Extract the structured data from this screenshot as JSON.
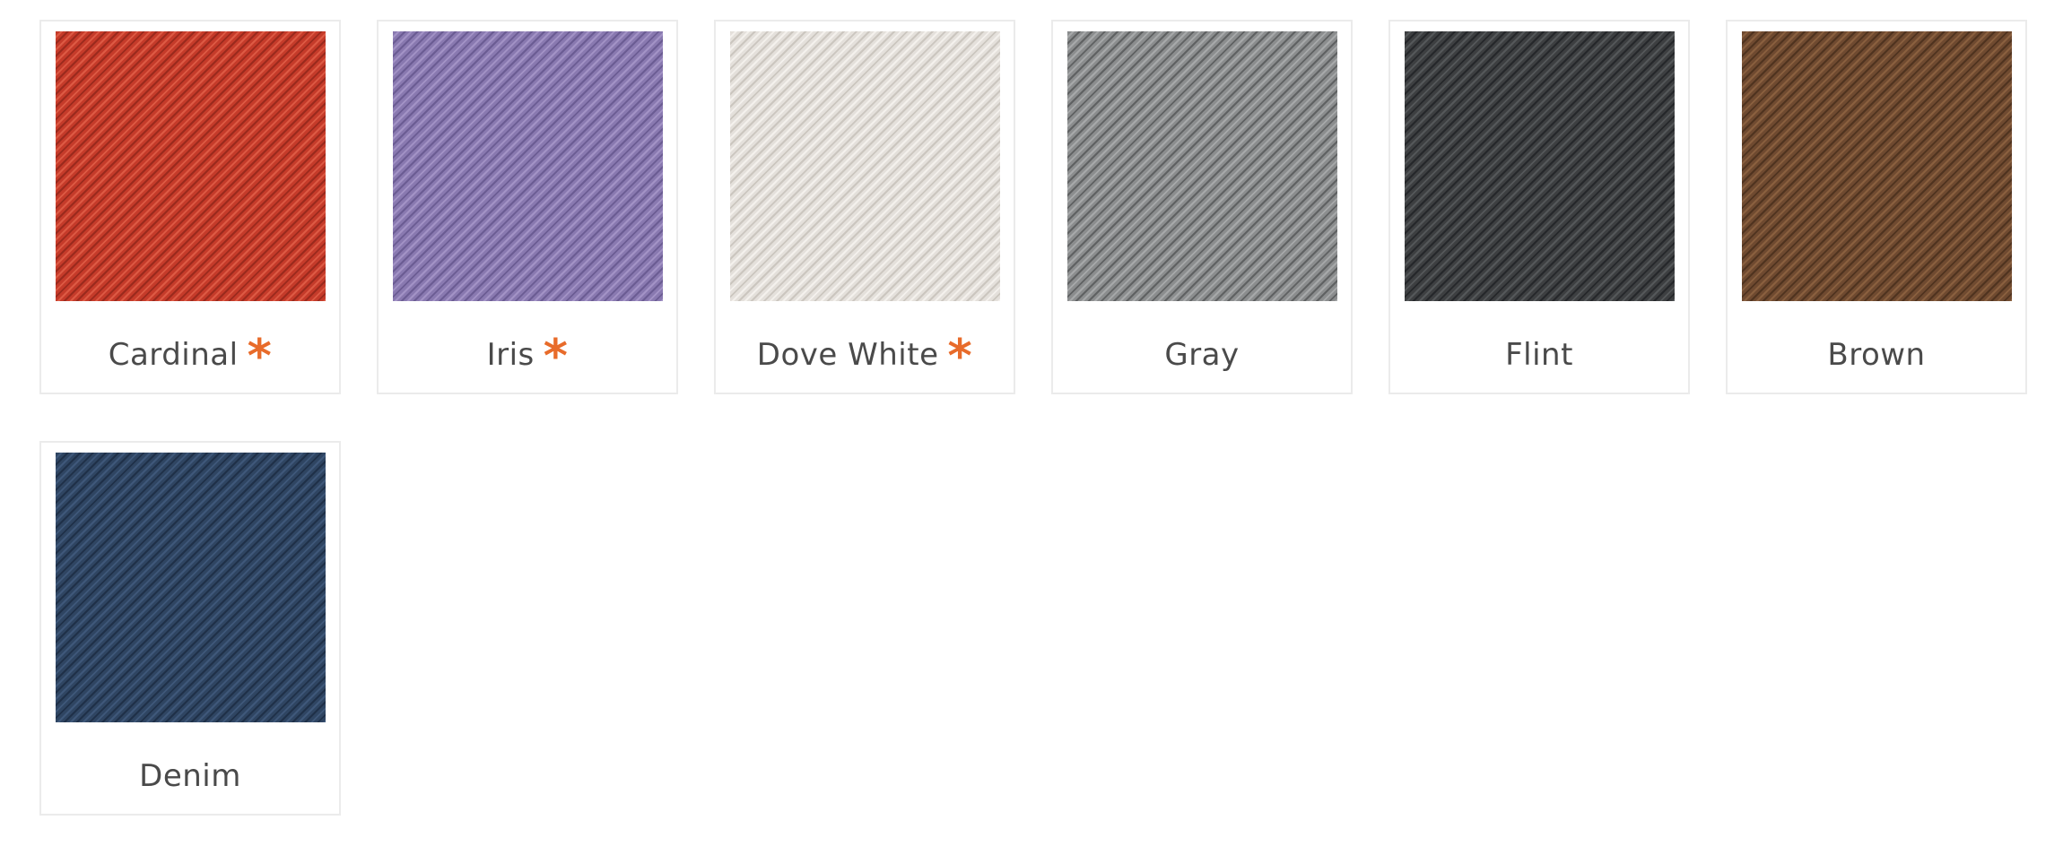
{
  "colors": {
    "accent_asterisk": "#e86b2a",
    "label_text": "#4a4a4a",
    "card_border": "#ebebeb"
  },
  "marker_symbol": "*",
  "swatches": [
    {
      "name": "Cardinal",
      "marked": true,
      "base": "#c53b2a",
      "light": "#dd5a44",
      "dark": "#9a2a1d"
    },
    {
      "name": "Iris",
      "marked": true,
      "base": "#8979b0",
      "light": "#a393c6",
      "dark": "#6b5c93"
    },
    {
      "name": "Dove White",
      "marked": true,
      "base": "#e4e0db",
      "light": "#f4f1ed",
      "dark": "#cbc6bf"
    },
    {
      "name": "Gray",
      "marked": false,
      "base": "#8b8d8e",
      "light": "#a7a9aa",
      "dark": "#5f6162"
    },
    {
      "name": "Flint",
      "marked": false,
      "base": "#3d3f41",
      "light": "#55585a",
      "dark": "#25272a"
    },
    {
      "name": "Brown",
      "marked": false,
      "base": "#6f4a30",
      "light": "#8a603f",
      "dark": "#4f331f"
    },
    {
      "name": "Denim",
      "marked": false,
      "base": "#2f4562",
      "light": "#3f587a",
      "dark": "#1f3048"
    }
  ]
}
